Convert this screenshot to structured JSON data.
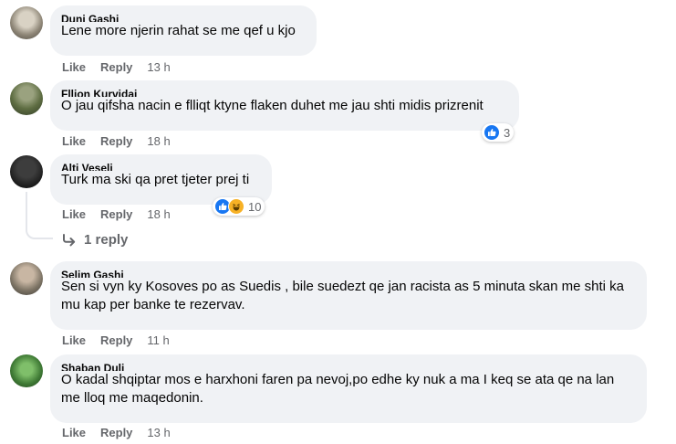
{
  "comments": [
    {
      "author": "Duni Gashi",
      "text": "Lene more njerin rahat se me qef u kjo",
      "like": "Like",
      "reply": "Reply",
      "time": "13 h"
    },
    {
      "author": "Flljon Kurvidaj",
      "text": "O jau qifsha nacin e flliqt ktyne flaken duhet me jau shti midis prizrenit",
      "like": "Like",
      "reply": "Reply",
      "time": "18 h",
      "reaction_count": "3"
    },
    {
      "author": "Alti Veseli",
      "text": "Turk ma ski qa pret tjeter prej ti",
      "like": "Like",
      "reply": "Reply",
      "time": "18 h",
      "reaction_count": "10"
    },
    {
      "author": "Selim Gashi",
      "text": "Sen si vyn ky Kosoves po as Suedis , bile suedezt qe jan racista as 5 minuta skan me shti ka mu kap per banke te rezervav.",
      "like": "Like",
      "reply": "Reply",
      "time": "11 h"
    },
    {
      "author": "Shaban Duli",
      "text": "O kadal shqiptar mos e harxhoni faren pa nevoj,po edhe ky nuk a ma I keq se ata qe na lan me lloq me maqedonin.",
      "like": "Like",
      "reply": "Reply",
      "time": "13 h"
    }
  ],
  "view_replies": "1 reply",
  "colors": {
    "bubble": "#f0f2f5",
    "meta": "#65676b",
    "like_blue": "#1877f2",
    "haha_yellow": "#f7b125"
  }
}
